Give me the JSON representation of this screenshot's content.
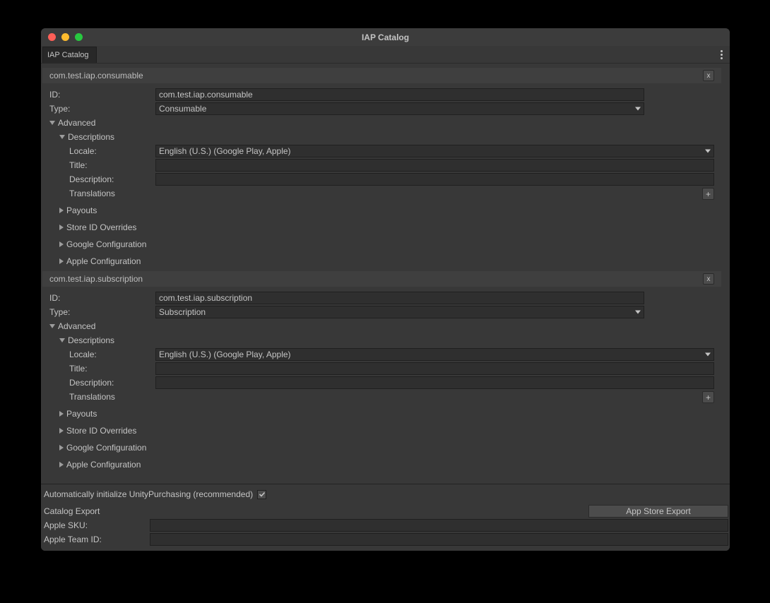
{
  "window": {
    "title": "IAP Catalog",
    "tab": "IAP Catalog"
  },
  "labels": {
    "id": "ID:",
    "type": "Type:",
    "advanced": "Advanced",
    "descriptions": "Descriptions",
    "locale": "Locale:",
    "title": "Title:",
    "description": "Description:",
    "translations": "Translations",
    "payouts": "Payouts",
    "storeOverrides": "Store ID Overrides",
    "googleConfig": "Google Configuration",
    "appleConfig": "Apple Configuration",
    "remove": "x",
    "add": "+"
  },
  "items": [
    {
      "header": "com.test.iap.consumable",
      "id": "com.test.iap.consumable",
      "type": "Consumable",
      "locale": "English (U.S.) (Google Play, Apple)",
      "titleVal": "",
      "descVal": ""
    },
    {
      "header": "com.test.iap.subscription",
      "id": "com.test.iap.subscription",
      "type": "Subscription",
      "locale": "English (U.S.) (Google Play, Apple)",
      "titleVal": "",
      "descVal": ""
    }
  ],
  "footer": {
    "autoInitLabel": "Automatically initialize UnityPurchasing (recommended)",
    "autoInitChecked": true,
    "catalogExport": "Catalog Export",
    "appStoreExport": "App Store Export",
    "appleSkuLabel": "Apple SKU:",
    "appleSkuVal": "",
    "appleTeamLabel": "Apple Team ID:",
    "appleTeamVal": ""
  }
}
